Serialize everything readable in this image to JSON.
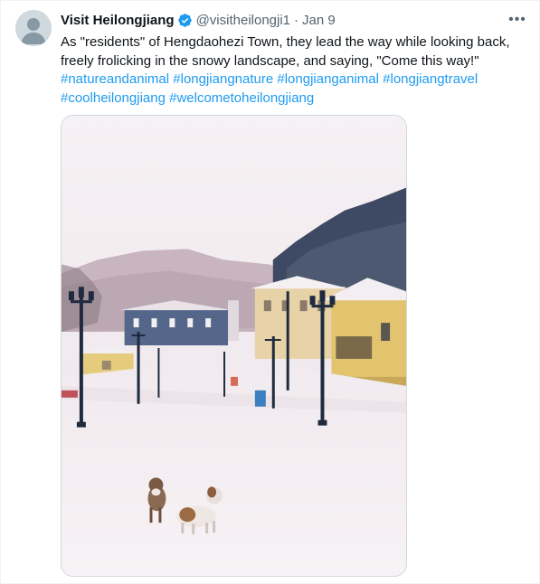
{
  "tweet": {
    "display_name": "Visit Heilongjiang",
    "handle": "@visitheilongji1",
    "separator": "·",
    "date": "Jan 9",
    "more_label": "•••",
    "text": "As \"residents\" of Hengdaohezi Town, they lead the way while looking back, freely frolicking in the snowy landscape, and saying, \"Come this way!\"",
    "hashtags": [
      "#natureandanimal",
      "#longjiangnature",
      "#longjianganimal",
      "#longjiangtravel",
      "#coolheilongjiang",
      "#welcometoheilongjiang"
    ],
    "verified_icon": "verified-badge-icon",
    "more_icon": "more-options-icon",
    "media": {
      "kind": "photo",
      "scene": "snowy town street with lampposts, yellow buildings, forested mountains and two dogs"
    }
  },
  "colors": {
    "link": "#1d9bf0",
    "text": "#0f1419",
    "secondary": "#536471",
    "border": "#cfd9de"
  }
}
